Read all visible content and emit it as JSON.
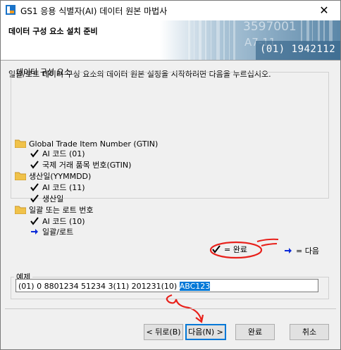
{
  "window": {
    "title": "GS1 응용 식별자(AI) 데이터 원본 마법사",
    "close_symbol": "✕"
  },
  "banner": {
    "heading": "데이터 구성 요소 설치 준비",
    "barcode_text": "(01) 1942112",
    "art_text_1": "3597001",
    "art_text_2": "A7-11"
  },
  "intro": "일괄/로트 데이터 구성 요소의 데이터 원본 설정을 시작하려면 다음을 누르십시오.",
  "components": {
    "legend": "데이터 구성 요소",
    "groups": [
      {
        "label": "Global Trade Item Number (GTIN)",
        "items": [
          {
            "label": "AI 코드 (01)",
            "status": "done"
          },
          {
            "label": "국제 거래 품목 번호(GTIN)",
            "status": "done"
          }
        ]
      },
      {
        "label": "생산일(YYMMDD)",
        "items": [
          {
            "label": "AI 코드 (11)",
            "status": "done"
          },
          {
            "label": "생산일",
            "status": "done"
          }
        ]
      },
      {
        "label": "일괄 또는 로트 번호",
        "items": [
          {
            "label": "AI 코드 (10)",
            "status": "done"
          },
          {
            "label": "일괄/로트",
            "status": "next"
          }
        ]
      }
    ],
    "key_done": "= 완료",
    "key_next": "= 다음"
  },
  "example": {
    "legend": "예제",
    "value_plain": "(01) 0 8801234 51234 3(11) 201231(10) ",
    "value_selected": "ABC123"
  },
  "buttons": {
    "back": "< 뒤로(B)",
    "next": "다음(N) >",
    "finish": "완료",
    "cancel": "취소"
  },
  "colors": {
    "selection": "#0078d7",
    "annotation": "#e8201a",
    "next_arrow": "#0a2ad8"
  }
}
